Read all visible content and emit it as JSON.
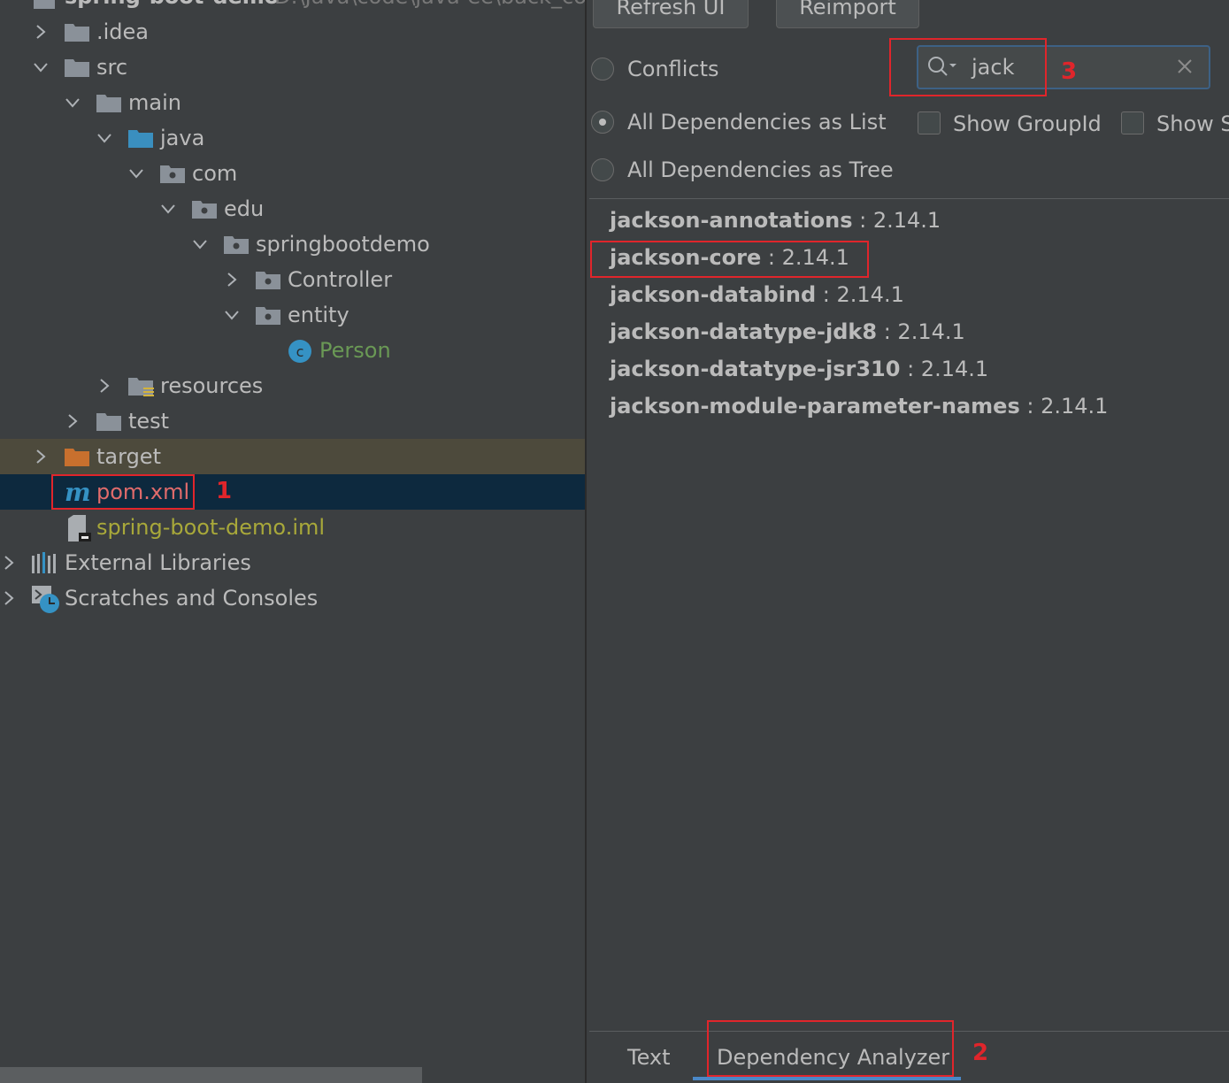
{
  "project": {
    "name": "spring-boot-demo",
    "path": "D:\\Java\\code\\java-ee\\back_coc"
  },
  "tree": [
    {
      "label": ".idea",
      "depth": 1,
      "expanded": false,
      "icon": "folder-icon"
    },
    {
      "label": "src",
      "depth": 1,
      "expanded": true,
      "icon": "folder-icon"
    },
    {
      "label": "main",
      "depth": 2,
      "expanded": true,
      "icon": "folder-icon"
    },
    {
      "label": "java",
      "depth": 3,
      "expanded": true,
      "icon": "source-folder-icon"
    },
    {
      "label": "com",
      "depth": 4,
      "expanded": true,
      "icon": "package-icon"
    },
    {
      "label": "edu",
      "depth": 5,
      "expanded": true,
      "icon": "package-icon"
    },
    {
      "label": "springbootdemo",
      "depth": 6,
      "expanded": true,
      "icon": "package-icon"
    },
    {
      "label": "Controller",
      "depth": 7,
      "expanded": false,
      "icon": "package-icon"
    },
    {
      "label": "entity",
      "depth": 7,
      "expanded": true,
      "icon": "package-icon"
    },
    {
      "label": "Person",
      "depth": 8,
      "expanded": null,
      "icon": "class-icon"
    },
    {
      "label": "resources",
      "depth": 3,
      "expanded": false,
      "icon": "resources-folder-icon"
    },
    {
      "label": "test",
      "depth": 2,
      "expanded": false,
      "icon": "folder-icon"
    },
    {
      "label": "target",
      "depth": 1,
      "expanded": false,
      "icon": "excluded-folder-icon"
    },
    {
      "label": "pom.xml",
      "depth": 1,
      "expanded": null,
      "icon": "maven-icon"
    },
    {
      "label": "spring-boot-demo.iml",
      "depth": 1,
      "expanded": null,
      "icon": "iml-file-icon"
    },
    {
      "label": "External Libraries",
      "depth": 0,
      "expanded": false,
      "icon": "libraries-icon"
    },
    {
      "label": "Scratches and Consoles",
      "depth": 0,
      "expanded": false,
      "icon": "scratches-icon"
    }
  ],
  "toolbar": {
    "refresh_label": "Refresh UI",
    "reimport_label": "Reimport"
  },
  "options": {
    "conflicts": "Conflicts",
    "as_list": "All Dependencies as List",
    "as_tree": "All Dependencies as Tree",
    "selected": "All Dependencies as List",
    "show_groupid": "Show GroupId",
    "show_s": "Show S"
  },
  "search": {
    "value": "jack"
  },
  "dependencies": [
    {
      "name": "jackson-annotations",
      "version": " : 2.14.1"
    },
    {
      "name": "jackson-core",
      "version": " : 2.14.1"
    },
    {
      "name": "jackson-databind",
      "version": " : 2.14.1"
    },
    {
      "name": "jackson-datatype-jdk8",
      "version": " : 2.14.1"
    },
    {
      "name": "jackson-datatype-jsr310",
      "version": " : 2.14.1"
    },
    {
      "name": "jackson-module-parameter-names",
      "version": " : 2.14.1"
    }
  ],
  "tabs": {
    "text": "Text",
    "analyzer": "Dependency Analyzer",
    "active": "Dependency Analyzer"
  },
  "annotations": {
    "one": "1",
    "two": "2",
    "three": "3"
  },
  "colors": {
    "background": "#3c3f41",
    "selection": "#0d293e",
    "excluded": "#4d4a3c",
    "annotation": "#e0252b",
    "pom_text": "#e06b6b",
    "iml_text": "#a8a83a",
    "person_text": "#6a9955"
  }
}
